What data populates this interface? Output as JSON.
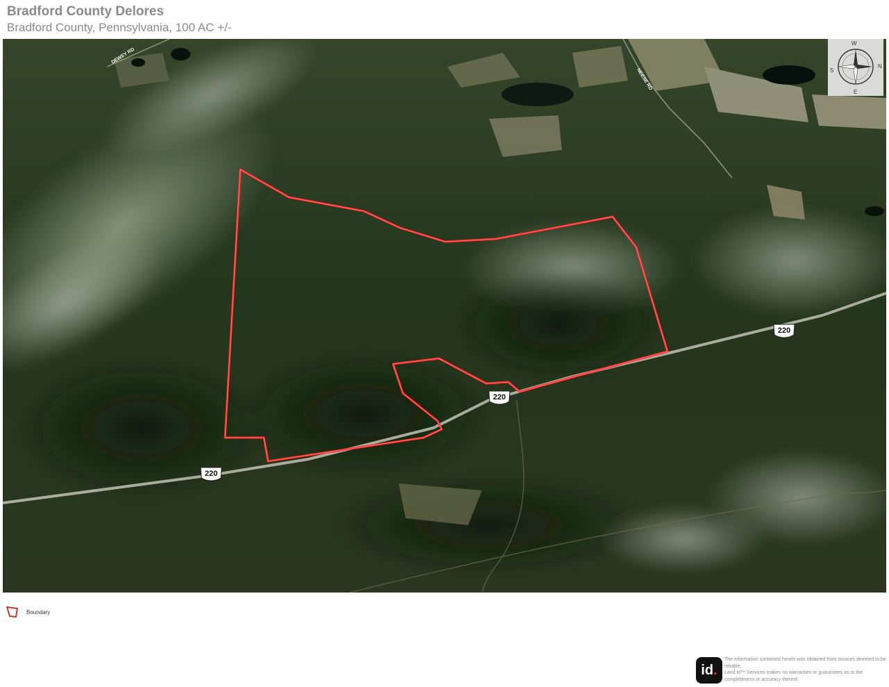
{
  "header": {
    "title": "Bradford County Delores",
    "subtitle": "Bradford County, Pennsylvania, 100 AC +/-"
  },
  "map": {
    "type": "satellite-3d",
    "roads": [
      {
        "name": "DEWEY RD"
      },
      {
        "name": "NEESE RD"
      }
    ],
    "route_shield_label": "220",
    "boundary_color": "#ff2a2a",
    "compass_icon": "compass-rose-icon",
    "compass": {
      "n": "N",
      "s": "S",
      "e": "E",
      "w": "W"
    }
  },
  "legend": {
    "items": [
      {
        "label": "Boundary",
        "icon": "boundary-polygon-icon",
        "color": "#c0392b"
      }
    ]
  },
  "footer": {
    "logo_text": "id",
    "logo_dot": ".",
    "line1": "The information contained herein was obtained from sources deemed to be reliable.",
    "line2": "Land id™ Services makes no warranties or guarantees as to the completeness or accuracy thereof."
  }
}
